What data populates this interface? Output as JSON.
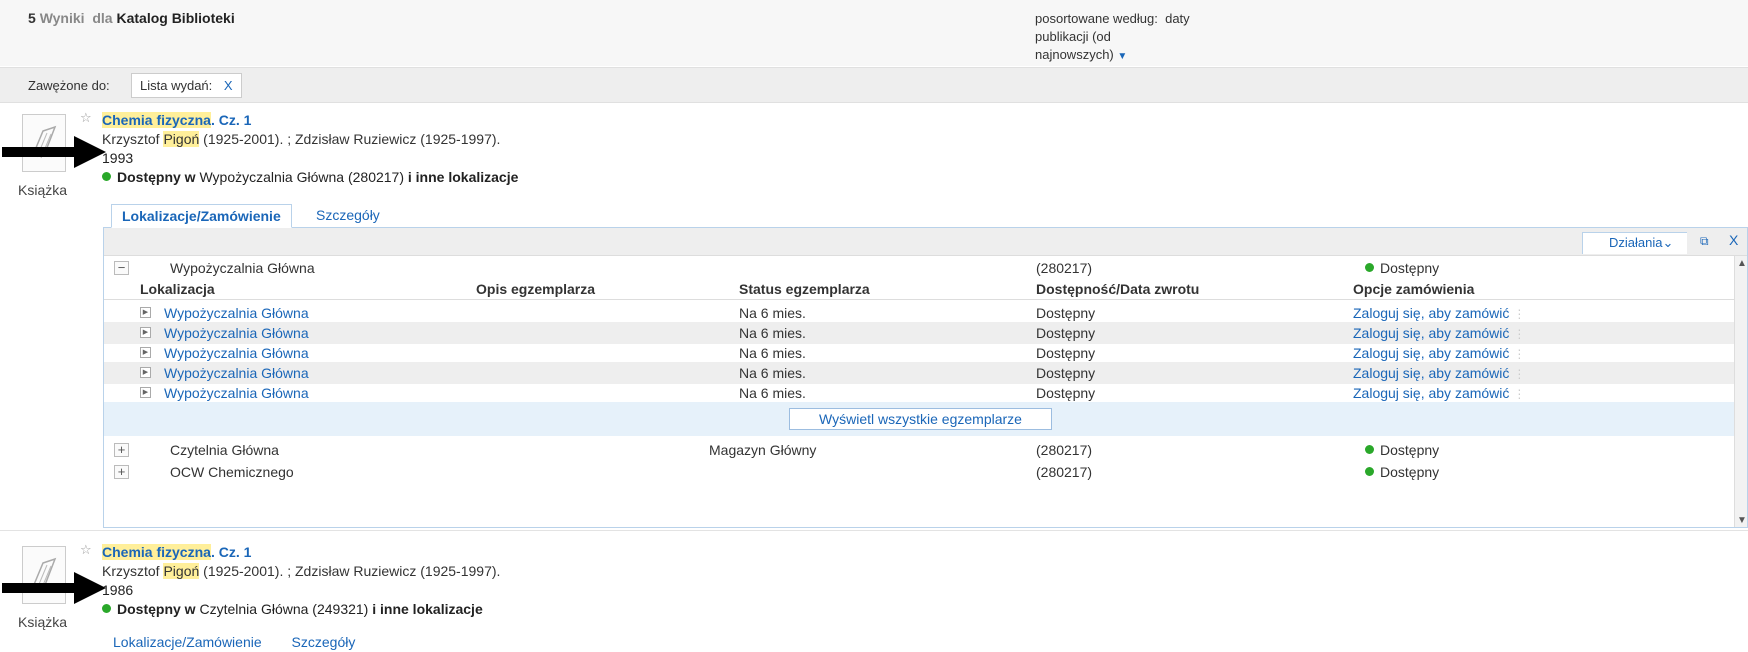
{
  "header": {
    "count": "5",
    "results_word": "Wyniki",
    "for_word": "dla",
    "catalog": "Katalog Biblioteki",
    "sort_label_line1": "posortowane według:",
    "sort_value_1": "daty",
    "sort_value_2": "publikacji (od",
    "sort_value_3": "najnowszych)"
  },
  "refine": {
    "label": "Zawężone do:",
    "chip_label": "Lista wydań:",
    "chip_remove": "X"
  },
  "results": [
    {
      "type_label": "Książka",
      "title_part": "Chemia fizyczna",
      "title_rest": ". Cz. 1",
      "author_pre": "Krzysztof ",
      "author_hl": "Pigoń",
      "author_post": " (1925-2001). ; Zdzisław Ruziewicz (1925-1997).",
      "year": "1993",
      "avail_bold": "Dostępny w",
      "avail_loc": "Wypożyczalnia Główna  (280217)",
      "avail_more": "i inne lokalizacje"
    },
    {
      "type_label": "Książka",
      "title_part": "Chemia fizyczna",
      "title_rest": ". Cz. 1",
      "author_pre": "Krzysztof ",
      "author_hl": "Pigoń",
      "author_post": " (1925-2001). ; Zdzisław Ruziewicz (1925-1997).",
      "year": "1986",
      "avail_bold": "Dostępny w",
      "avail_loc": "Czytelnia Główna  (249321)",
      "avail_more": "i inne lokalizacje",
      "tab_locations": "Lokalizacje/Zamówienie",
      "tab_details": "Szczegóły"
    }
  ],
  "tabs": {
    "locations": "Lokalizacje/Zamówienie",
    "details": "Szczegóły"
  },
  "panel": {
    "actions": "Działania",
    "actions_chevron": "⌄",
    "close": "X",
    "location_rows": [
      {
        "toggle": "−",
        "name": "Wypożyczalnia Główna",
        "shelf": "",
        "call": "(280217)",
        "status": "Dostępny"
      },
      {
        "toggle": "+",
        "name": "Czytelnia Główna",
        "shelf": "Magazyn Główny",
        "call": "(280217)",
        "status": "Dostępny"
      },
      {
        "toggle": "+",
        "name": "OCW Chemicznego",
        "shelf": "",
        "call": "(280217)",
        "status": "Dostępny"
      }
    ],
    "columns": {
      "location": "Lokalizacja",
      "description": "Opis egzemplarza",
      "item_status": "Status egzemplarza",
      "availability": "Dostępność/Data zwrotu",
      "order": "Opcje zamówienia"
    },
    "items": [
      {
        "location": "Wypożyczalnia Główna",
        "status": "Na 6 mies.",
        "availability": "Dostępny",
        "order": "Zaloguj się, aby zamówić"
      },
      {
        "location": "Wypożyczalnia Główna",
        "status": "Na 6 mies.",
        "availability": "Dostępny",
        "order": "Zaloguj się, aby zamówić"
      },
      {
        "location": "Wypożyczalnia Główna",
        "status": "Na 6 mies.",
        "availability": "Dostępny",
        "order": "Zaloguj się, aby zamówić"
      },
      {
        "location": "Wypożyczalnia Główna",
        "status": "Na 6 mies.",
        "availability": "Dostępny",
        "order": "Zaloguj się, aby zamówić"
      },
      {
        "location": "Wypożyczalnia Główna",
        "status": "Na 6 mies.",
        "availability": "Dostępny",
        "order": "Zaloguj się, aby zamówić"
      }
    ],
    "show_all": "Wyświetl wszystkie egzemplarze"
  },
  "colors": {
    "link": "#1a66b8",
    "available_dot": "#2aa82a",
    "highlight": "#ffef9a"
  }
}
